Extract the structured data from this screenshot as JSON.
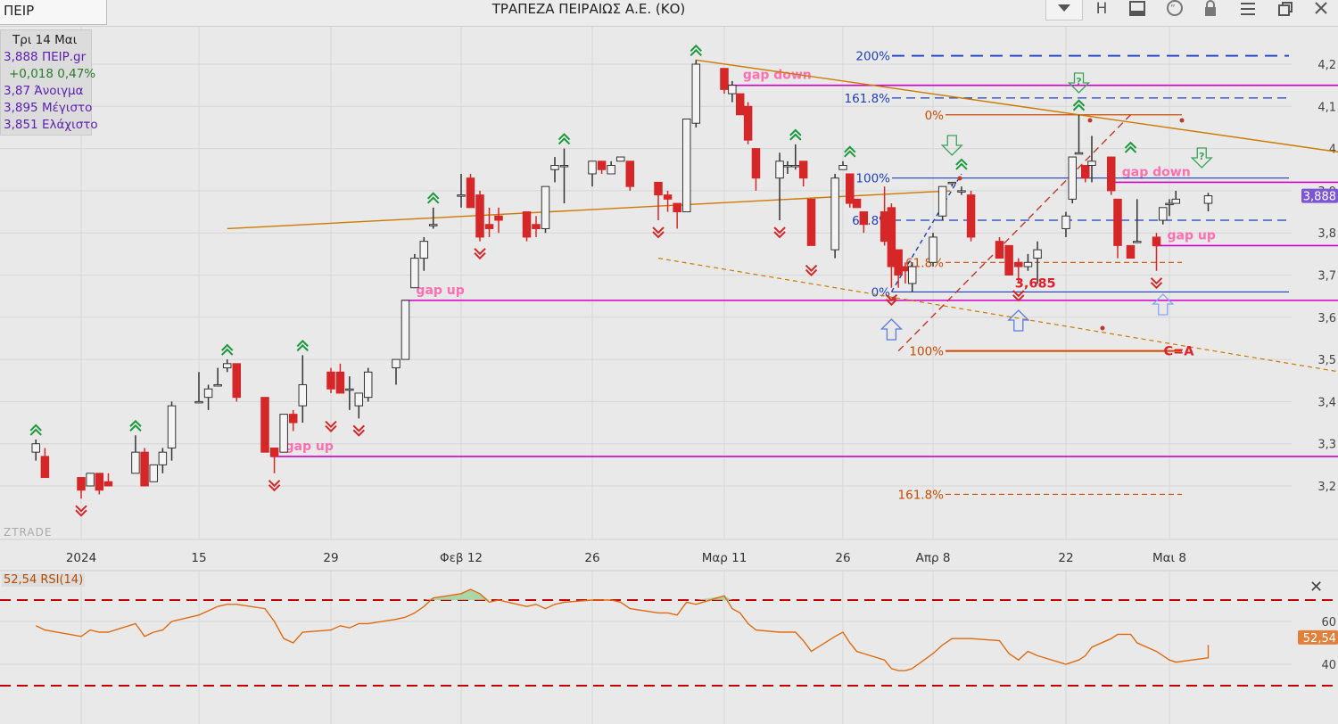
{
  "header": {
    "symbol": "ΠΕΙΡ",
    "title": "ΤΡΑΠΕΖΑ ΠΕΙΡΑΙΩΣ Α.Ε. (ΚΟ)",
    "h_label": "H"
  },
  "infobox": {
    "date": "Τρι 14 Μαι",
    "price": "3,888 ΠΕΙΡ.gr",
    "change": "+0,018 0,47%",
    "open": "3,87 Άνοιγμα",
    "high": "3,895 Μέγιστο",
    "low": "3,851 Ελάχιστο"
  },
  "colors": {
    "up_outline": "#333333",
    "down": "#d62728",
    "fib_blue": "#1f3fbf",
    "fib_orange": "#cc4a00",
    "gap_line": "#d000c8",
    "gap_text": "#ff6fb0",
    "trend": "#cc7a00",
    "rsi_line": "#e06a10",
    "rsi_band": "#c00000",
    "rsi_fill": "#9fd49f",
    "price_badge": "#7b57d6",
    "rsi_badge": "#e0803a"
  },
  "watermark": "ZTRADE",
  "chart_data": {
    "type": "candlestick",
    "title": "ΤΡΑΠΕΖΑ ΠΕΙΡΑΙΩΣ Α.Ε. (ΚΟ)",
    "ylim": [
      3.12,
      4.24
    ],
    "y_ticks": [
      "4,2",
      "4,1",
      "4",
      "3,9",
      "3,8",
      "3,7",
      "3,6",
      "3,5",
      "3,4",
      "3,3",
      "3,2"
    ],
    "y_tick_values": [
      4.2,
      4.1,
      4.0,
      3.9,
      3.8,
      3.7,
      3.6,
      3.5,
      3.4,
      3.3,
      3.2
    ],
    "x_tick_labels": [
      "2024",
      "15",
      "29",
      "Φεβ 12",
      "26",
      "Μαρ 11",
      "26",
      "Απρ 8",
      "22",
      "Μαι 8"
    ],
    "x_tick_dates": [
      "2024-01-02",
      "2024-01-15",
      "2024-01-29",
      "2024-02-12",
      "2024-02-26",
      "2024-03-11",
      "2024-03-26",
      "2024-04-08",
      "2024-04-22",
      "2024-05-08"
    ],
    "candles": [
      {
        "date": "2023-12-28",
        "open": 3.28,
        "high": 3.31,
        "low": 3.26,
        "close": 3.3
      },
      {
        "date": "2023-12-29",
        "open": 3.27,
        "high": 3.29,
        "low": 3.22,
        "close": 3.22
      },
      {
        "date": "2024-01-02",
        "open": 3.22,
        "high": 3.22,
        "low": 3.17,
        "close": 3.19
      },
      {
        "date": "2024-01-03",
        "open": 3.2,
        "high": 3.23,
        "low": 3.2,
        "close": 3.23
      },
      {
        "date": "2024-01-04",
        "open": 3.23,
        "high": 3.23,
        "low": 3.18,
        "close": 3.19
      },
      {
        "date": "2024-01-05",
        "open": 3.21,
        "high": 3.23,
        "low": 3.2,
        "close": 3.2
      },
      {
        "date": "2024-01-08",
        "open": 3.23,
        "high": 3.32,
        "low": 3.23,
        "close": 3.28
      },
      {
        "date": "2024-01-09",
        "open": 3.28,
        "high": 3.29,
        "low": 3.2,
        "close": 3.2
      },
      {
        "date": "2024-01-10",
        "open": 3.21,
        "high": 3.25,
        "low": 3.21,
        "close": 3.25
      },
      {
        "date": "2024-01-11",
        "open": 3.25,
        "high": 3.29,
        "low": 3.23,
        "close": 3.28
      },
      {
        "date": "2024-01-12",
        "open": 3.29,
        "high": 3.4,
        "low": 3.26,
        "close": 3.39
      },
      {
        "date": "2024-01-15",
        "open": 3.4,
        "high": 3.47,
        "low": 3.4,
        "close": 3.4
      },
      {
        "date": "2024-01-16",
        "open": 3.41,
        "high": 3.44,
        "low": 3.38,
        "close": 3.43
      },
      {
        "date": "2024-01-17",
        "open": 3.44,
        "high": 3.48,
        "low": 3.44,
        "close": 3.44
      },
      {
        "date": "2024-01-18",
        "open": 3.48,
        "high": 3.5,
        "low": 3.47,
        "close": 3.49
      },
      {
        "date": "2024-01-19",
        "open": 3.49,
        "high": 3.49,
        "low": 3.4,
        "close": 3.41
      },
      {
        "date": "2024-01-22",
        "open": 3.41,
        "high": 3.41,
        "low": 3.28,
        "close": 3.28
      },
      {
        "date": "2024-01-23",
        "open": 3.29,
        "high": 3.29,
        "low": 3.23,
        "close": 3.27
      },
      {
        "date": "2024-01-24",
        "open": 3.28,
        "high": 3.37,
        "low": 3.28,
        "close": 3.37
      },
      {
        "date": "2024-01-25",
        "open": 3.37,
        "high": 3.38,
        "low": 3.33,
        "close": 3.35
      },
      {
        "date": "2024-01-26",
        "open": 3.39,
        "high": 3.51,
        "low": 3.35,
        "close": 3.44
      },
      {
        "date": "2024-01-29",
        "open": 3.47,
        "high": 3.48,
        "low": 3.42,
        "close": 3.43
      },
      {
        "date": "2024-01-30",
        "open": 3.47,
        "high": 3.49,
        "low": 3.42,
        "close": 3.42
      },
      {
        "date": "2024-01-31",
        "open": 3.43,
        "high": 3.46,
        "low": 3.38,
        "close": 3.43
      },
      {
        "date": "2024-02-01",
        "open": 3.39,
        "high": 3.42,
        "low": 3.36,
        "close": 3.42
      },
      {
        "date": "2024-02-02",
        "open": 3.41,
        "high": 3.48,
        "low": 3.4,
        "close": 3.47
      },
      {
        "date": "2024-02-05",
        "open": 3.48,
        "high": 3.5,
        "low": 3.44,
        "close": 3.5
      },
      {
        "date": "2024-02-06",
        "open": 3.5,
        "high": 3.64,
        "low": 3.5,
        "close": 3.64
      },
      {
        "date": "2024-02-07",
        "open": 3.67,
        "high": 3.75,
        "low": 3.67,
        "close": 3.74
      },
      {
        "date": "2024-02-08",
        "open": 3.74,
        "high": 3.79,
        "low": 3.71,
        "close": 3.78
      },
      {
        "date": "2024-02-09",
        "open": 3.82,
        "high": 3.86,
        "low": 3.81,
        "close": 3.82
      },
      {
        "date": "2024-02-12",
        "open": 3.89,
        "high": 3.94,
        "low": 3.86,
        "close": 3.89
      },
      {
        "date": "2024-02-13",
        "open": 3.93,
        "high": 3.94,
        "low": 3.86,
        "close": 3.86
      },
      {
        "date": "2024-02-14",
        "open": 3.89,
        "high": 3.9,
        "low": 3.78,
        "close": 3.79
      },
      {
        "date": "2024-02-15",
        "open": 3.82,
        "high": 3.86,
        "low": 3.79,
        "close": 3.81
      },
      {
        "date": "2024-02-16",
        "open": 3.84,
        "high": 3.86,
        "low": 3.8,
        "close": 3.83
      },
      {
        "date": "2024-02-19",
        "open": 3.85,
        "high": 3.85,
        "low": 3.78,
        "close": 3.79
      },
      {
        "date": "2024-02-20",
        "open": 3.82,
        "high": 3.84,
        "low": 3.79,
        "close": 3.81
      },
      {
        "date": "2024-02-21",
        "open": 3.81,
        "high": 3.91,
        "low": 3.8,
        "close": 3.91
      },
      {
        "date": "2024-02-22",
        "open": 3.95,
        "high": 3.98,
        "low": 3.92,
        "close": 3.96
      },
      {
        "date": "2024-02-23",
        "open": 3.96,
        "high": 4.0,
        "low": 3.87,
        "close": 3.96
      },
      {
        "date": "2024-02-26",
        "open": 3.94,
        "high": 3.97,
        "low": 3.91,
        "close": 3.97
      },
      {
        "date": "2024-02-27",
        "open": 3.97,
        "high": 3.97,
        "low": 3.94,
        "close": 3.95
      },
      {
        "date": "2024-02-28",
        "open": 3.94,
        "high": 3.97,
        "low": 3.94,
        "close": 3.96
      },
      {
        "date": "2024-02-29",
        "open": 3.97,
        "high": 3.98,
        "low": 3.97,
        "close": 3.98
      },
      {
        "date": "2024-03-01",
        "open": 3.97,
        "high": 3.97,
        "low": 3.9,
        "close": 3.91
      },
      {
        "date": "2024-03-04",
        "open": 3.92,
        "high": 3.92,
        "low": 3.83,
        "close": 3.89
      },
      {
        "date": "2024-03-05",
        "open": 3.89,
        "high": 3.9,
        "low": 3.85,
        "close": 3.88
      },
      {
        "date": "2024-03-06",
        "open": 3.87,
        "high": 3.87,
        "low": 3.81,
        "close": 3.85
      },
      {
        "date": "2024-03-07",
        "open": 3.85,
        "high": 4.07,
        "low": 3.85,
        "close": 4.07
      },
      {
        "date": "2024-03-08",
        "open": 4.06,
        "high": 4.21,
        "low": 4.05,
        "close": 4.2
      },
      {
        "date": "2024-03-11",
        "open": 4.19,
        "high": 4.19,
        "low": 4.13,
        "close": 4.14
      },
      {
        "date": "2024-03-12",
        "open": 4.13,
        "high": 4.16,
        "low": 4.11,
        "close": 4.15
      },
      {
        "date": "2024-03-13",
        "open": 4.13,
        "high": 4.13,
        "low": 4.08,
        "close": 4.08
      },
      {
        "date": "2024-03-14",
        "open": 4.1,
        "high": 4.11,
        "low": 4.01,
        "close": 4.02
      },
      {
        "date": "2024-03-15",
        "open": 4.0,
        "high": 4.0,
        "low": 3.9,
        "close": 3.93
      },
      {
        "date": "2024-03-18",
        "open": 3.93,
        "high": 3.99,
        "low": 3.83,
        "close": 3.97
      },
      {
        "date": "2024-03-19",
        "open": 3.96,
        "high": 3.97,
        "low": 3.94,
        "close": 3.96
      },
      {
        "date": "2024-03-20",
        "open": 3.96,
        "high": 4.01,
        "low": 3.95,
        "close": 3.96
      },
      {
        "date": "2024-03-21",
        "open": 3.97,
        "high": 3.97,
        "low": 3.91,
        "close": 3.93
      },
      {
        "date": "2024-03-22",
        "open": 3.88,
        "high": 3.88,
        "low": 3.77,
        "close": 3.77
      },
      {
        "date": "2024-03-25",
        "open": 3.76,
        "high": 3.94,
        "low": 3.74,
        "close": 3.93
      },
      {
        "date": "2024-03-26",
        "open": 3.95,
        "high": 3.97,
        "low": 3.95,
        "close": 3.96
      },
      {
        "date": "2024-03-27",
        "open": 3.94,
        "high": 3.94,
        "low": 3.86,
        "close": 3.87
      },
      {
        "date": "2024-03-28",
        "open": 3.88,
        "high": 3.88,
        "low": 3.87,
        "close": 3.86
      },
      {
        "date": "2024-03-29",
        "open": 3.85,
        "high": 3.85,
        "low": 3.8,
        "close": 3.82
      },
      {
        "date": "2024-04-01",
        "open": 3.85,
        "high": 3.91,
        "low": 3.77,
        "close": 3.78
      },
      {
        "date": "2024-04-02",
        "open": 3.86,
        "high": 3.87,
        "low": 3.67,
        "close": 3.72
      },
      {
        "date": "2024-04-03",
        "open": 3.76,
        "high": 3.76,
        "low": 3.67,
        "close": 3.7
      },
      {
        "date": "2024-04-04",
        "open": 3.72,
        "high": 3.73,
        "low": 3.68,
        "close": 3.71
      },
      {
        "date": "2024-04-05",
        "open": 3.68,
        "high": 3.73,
        "low": 3.66,
        "close": 3.72
      },
      {
        "date": "2024-04-08",
        "open": 3.73,
        "high": 3.8,
        "low": 3.72,
        "close": 3.79
      },
      {
        "date": "2024-04-09",
        "open": 3.84,
        "high": 3.91,
        "low": 3.83,
        "close": 3.91
      },
      {
        "date": "2024-04-10",
        "open": 3.92,
        "high": 3.92,
        "low": 3.91,
        "close": 3.92
      },
      {
        "date": "2024-04-11",
        "open": 3.9,
        "high": 3.91,
        "low": 3.89,
        "close": 3.9
      },
      {
        "date": "2024-04-12",
        "open": 3.89,
        "high": 3.9,
        "low": 3.78,
        "close": 3.79
      },
      {
        "date": "2024-04-15",
        "open": 3.78,
        "high": 3.79,
        "low": 3.74,
        "close": 3.74
      },
      {
        "date": "2024-04-16",
        "open": 3.77,
        "high": 3.77,
        "low": 3.7,
        "close": 3.7
      },
      {
        "date": "2024-04-17",
        "open": 3.73,
        "high": 3.74,
        "low": 3.68,
        "close": 3.72
      },
      {
        "date": "2024-04-18",
        "open": 3.72,
        "high": 3.75,
        "low": 3.71,
        "close": 3.73
      },
      {
        "date": "2024-04-19",
        "open": 3.74,
        "high": 3.78,
        "low": 3.68,
        "close": 3.76
      },
      {
        "date": "2024-04-22",
        "open": 3.81,
        "high": 3.85,
        "low": 3.79,
        "close": 3.84
      },
      {
        "date": "2024-04-23",
        "open": 3.88,
        "high": 3.98,
        "low": 3.87,
        "close": 3.98
      },
      {
        "date": "2024-04-24",
        "open": 3.99,
        "high": 4.08,
        "low": 3.99,
        "close": 3.99
      },
      {
        "date": "2024-04-25",
        "open": 3.96,
        "high": 3.96,
        "low": 3.92,
        "close": 3.93
      },
      {
        "date": "2024-04-26",
        "open": 3.96,
        "high": 4.03,
        "low": 3.92,
        "close": 3.97
      },
      {
        "date": "2024-04-29",
        "open": 3.98,
        "high": 3.98,
        "low": 3.89,
        "close": 3.9
      },
      {
        "date": "2024-04-30",
        "open": 3.88,
        "high": 3.88,
        "low": 3.74,
        "close": 3.77
      },
      {
        "date": "2024-05-02",
        "open": 3.77,
        "high": 3.77,
        "low": 3.74,
        "close": 3.74
      },
      {
        "date": "2024-05-03",
        "open": 3.78,
        "high": 3.88,
        "low": 3.78,
        "close": 3.78
      },
      {
        "date": "2024-05-06",
        "open": 3.79,
        "high": 3.8,
        "low": 3.71,
        "close": 3.77
      },
      {
        "date": "2024-05-07",
        "open": 3.83,
        "high": 3.86,
        "low": 3.82,
        "close": 3.86
      },
      {
        "date": "2024-05-08",
        "open": 3.87,
        "high": 3.88,
        "low": 3.84,
        "close": 3.87
      },
      {
        "date": "2024-05-09",
        "open": 3.87,
        "high": 3.9,
        "low": 3.87,
        "close": 3.88
      },
      {
        "date": "2024-05-14",
        "open": 3.87,
        "high": 3.895,
        "low": 3.851,
        "close": 3.888
      }
    ],
    "horizontal_lines": [
      {
        "label": "gap down",
        "value": 4.15,
        "from": "2024-03-12"
      },
      {
        "label": "gap down",
        "value": 3.92,
        "from": "2024-04-29"
      },
      {
        "label": "gap up",
        "value": 3.77,
        "from": "2024-05-06"
      },
      {
        "label": "gap up",
        "value": 3.64,
        "from": "2024-02-06"
      },
      {
        "label": "gap up",
        "value": 3.27,
        "from": "2024-01-23"
      }
    ],
    "fib_blue": [
      {
        "label": "200%",
        "value": 4.22
      },
      {
        "label": "161.8%",
        "value": 4.12
      },
      {
        "label": "100%",
        "value": 3.93
      },
      {
        "label": "61.8%",
        "value": 3.83
      },
      {
        "label": "0%",
        "value": 3.66
      }
    ],
    "fib_orange": [
      {
        "label": "0%",
        "value": 4.08
      },
      {
        "label": "61.8%",
        "value": 3.73
      },
      {
        "label": "100%",
        "value": 3.52
      },
      {
        "label": "161.8%",
        "value": 3.18
      }
    ],
    "annotations": [
      {
        "text": "3,685",
        "value": 3.685,
        "date": "2024-04-17"
      },
      {
        "text": "C=A",
        "value": 3.52,
        "date": "2024-05-06"
      }
    ],
    "last_price_label": "3,888",
    "rsi": {
      "label": "52,54 RSI(14)",
      "last_label": "52,54",
      "last": 52.54,
      "overbought": 70,
      "oversold": 30,
      "ticks": [
        "60",
        "40"
      ],
      "tick_values": [
        60,
        40
      ],
      "ylim": [
        30,
        80
      ],
      "values": [
        58,
        56,
        53,
        56,
        55,
        55,
        59,
        53,
        55,
        56,
        60,
        63,
        65,
        67,
        68,
        68,
        66,
        60,
        52,
        50,
        55,
        56,
        58,
        57,
        59,
        59,
        61,
        62,
        64,
        67,
        71,
        73,
        75,
        73,
        69,
        70,
        67,
        68,
        66,
        68,
        69,
        70,
        70,
        70,
        69,
        66,
        64,
        64,
        63,
        69,
        68,
        72,
        66,
        64,
        59,
        56,
        55,
        55,
        55,
        51,
        46,
        53,
        55,
        50,
        46,
        45,
        42,
        38,
        37,
        37,
        38,
        45,
        49,
        52,
        52,
        52,
        51,
        45,
        42,
        46,
        44,
        40,
        41,
        42,
        44,
        48,
        52,
        54,
        54,
        50,
        46,
        44,
        42,
        41,
        43,
        43,
        47,
        48,
        49
      ]
    }
  }
}
